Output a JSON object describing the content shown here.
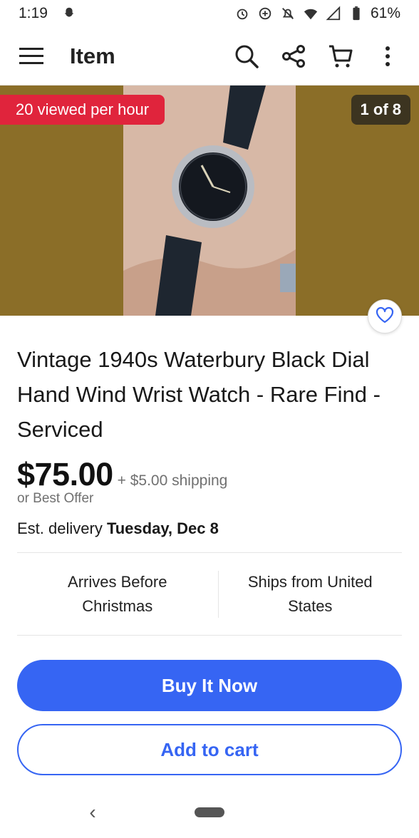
{
  "status_bar": {
    "time": "1:19",
    "battery": "61%",
    "icons": [
      "snapchat-icon",
      "alarm-icon",
      "data-saver-icon",
      "mute-icon",
      "wifi-icon",
      "signal-icon",
      "battery-icon"
    ]
  },
  "app_bar": {
    "title": "Item",
    "icons": [
      "menu-icon",
      "search-icon",
      "share-icon",
      "cart-icon",
      "more-icon"
    ]
  },
  "gallery": {
    "views_badge": "20 viewed per hour",
    "image_counter": "1 of 8",
    "background_color": "#8b6e28",
    "image_description_icon": "watch-photo"
  },
  "listing": {
    "title": "Vintage 1940s Waterbury Black Dial Hand Wind Wrist Watch - Rare Find - Serviced",
    "price": "$75.00",
    "shipping": "+ $5.00 shipping",
    "best_offer": "or Best Offer",
    "delivery_prefix": "Est. delivery ",
    "delivery_date": "Tuesday, Dec 8"
  },
  "features": [
    {
      "label": "Arrives Before Christmas"
    },
    {
      "label": "Ships from United States"
    }
  ],
  "actions": {
    "buy_now": "Buy It Now",
    "add_to_cart": "Add to cart"
  },
  "nav_bar": {
    "back_glyph": "‹"
  },
  "colors": {
    "accent": "#3665f3",
    "badge_red": "#e0243c",
    "counter_bg": "#3c3420"
  }
}
